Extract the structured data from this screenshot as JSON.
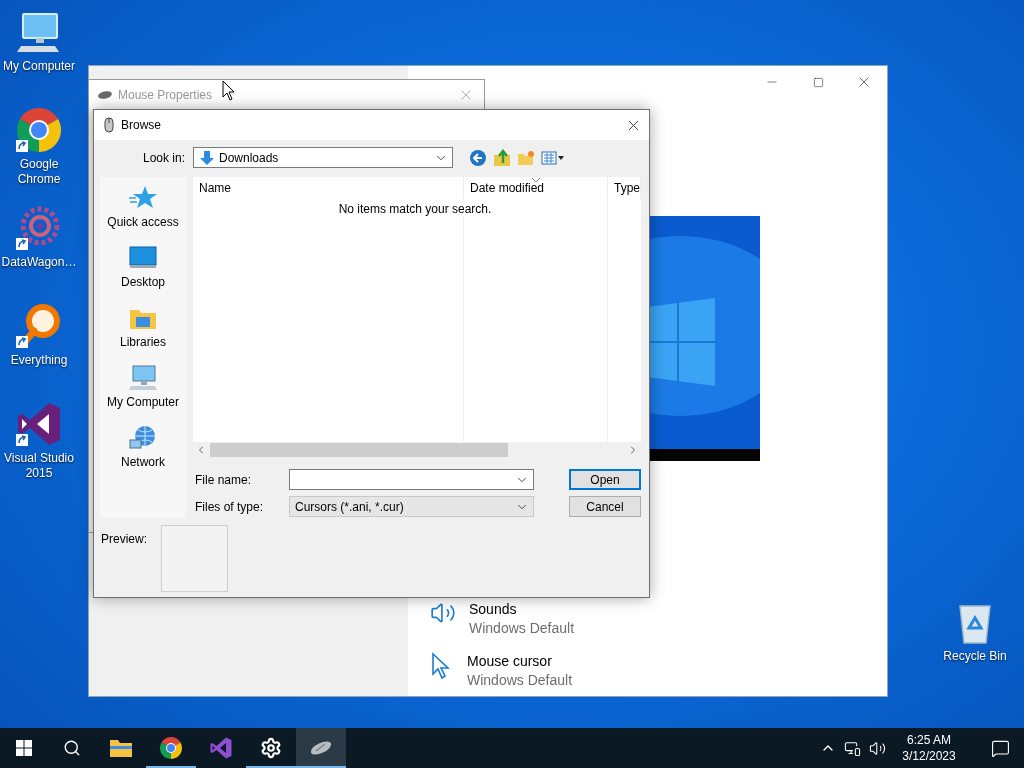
{
  "desktop_icons": [
    {
      "kind": "computer",
      "label": "My Computer",
      "shortcut": false
    },
    {
      "kind": "chrome",
      "label": "Google Chrome",
      "shortcut": true
    },
    {
      "kind": "datawagon",
      "label": "DataWagon…",
      "shortcut": true
    },
    {
      "kind": "everything",
      "label": "Everything",
      "shortcut": true
    },
    {
      "kind": "visualstudio",
      "label": "Visual Studio 2015",
      "shortcut": true
    }
  ],
  "recycle_bin": {
    "label": "Recycle Bin"
  },
  "settings_window": {
    "sections": [
      {
        "kind": "sound",
        "title": "Sounds",
        "value": "Windows Default"
      },
      {
        "kind": "cursor",
        "title": "Mouse cursor",
        "value": "Windows Default"
      }
    ]
  },
  "mouse_properties": {
    "title": "Mouse Properties"
  },
  "browse_dialog": {
    "title": "Browse",
    "look_in": {
      "label": "Look in:",
      "value": "Downloads"
    },
    "places": [
      {
        "kind": "star",
        "label": "Quick access"
      },
      {
        "kind": "desktop",
        "label": "Desktop"
      },
      {
        "kind": "libraries",
        "label": "Libraries"
      },
      {
        "kind": "computer",
        "label": "My Computer"
      },
      {
        "kind": "network",
        "label": "Network"
      }
    ],
    "columns": [
      {
        "label": "Name",
        "sorted": false
      },
      {
        "label": "Date modified",
        "sorted": true
      },
      {
        "label": "Type",
        "sorted": false
      }
    ],
    "empty_message": "No items match your search.",
    "file_name": {
      "label": "File name:"
    },
    "file_type": {
      "label": "Files of type:",
      "value": "Cursors (*.ani, *.cur)"
    },
    "buttons": [
      {
        "label": "Open",
        "default": true
      },
      {
        "label": "Cancel",
        "default": false
      }
    ],
    "preview": {
      "label": "Preview:"
    }
  },
  "taskbar": {
    "apps": [
      {
        "kind": "explorer",
        "running": false,
        "selected": false
      },
      {
        "kind": "chrome",
        "running": true,
        "selected": false
      },
      {
        "kind": "visualstudio",
        "running": false,
        "selected": false
      },
      {
        "kind": "settings",
        "running": true,
        "selected": false
      },
      {
        "kind": "mouse",
        "running": true,
        "selected": true
      }
    ],
    "time": "6:25 AM",
    "date": "3/12/2023"
  }
}
